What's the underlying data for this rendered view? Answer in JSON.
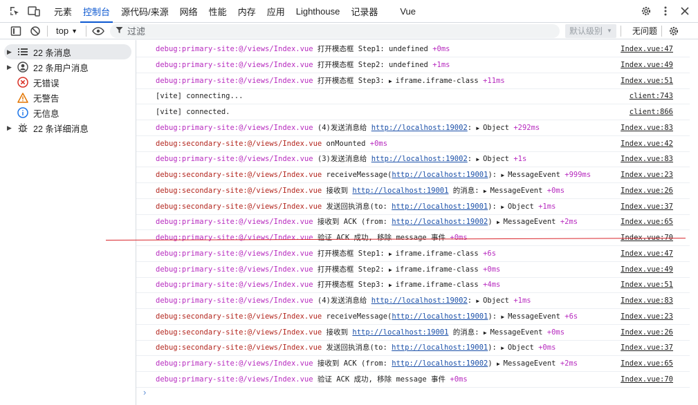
{
  "tabs": {
    "items": [
      "元素",
      "控制台",
      "源代码/来源",
      "网络",
      "性能",
      "内存",
      "应用",
      "Lighthouse",
      "记录器",
      "Vue"
    ],
    "active_index": 1
  },
  "toolbar": {
    "context": "top",
    "filter_placeholder": "过滤",
    "level_label": "默认级别",
    "issues_label": "无问题"
  },
  "sidebar": {
    "items": [
      {
        "label": "22 条消息",
        "icon": "list-icon",
        "expandable": true,
        "selected": true
      },
      {
        "label": "22 条用户消息",
        "icon": "user-icon",
        "expandable": true,
        "selected": false
      },
      {
        "label": "无错误",
        "icon": "error-icon",
        "expandable": false,
        "selected": false
      },
      {
        "label": "无警告",
        "icon": "warning-icon",
        "expandable": false,
        "selected": false
      },
      {
        "label": "无信息",
        "icon": "info-icon",
        "expandable": false,
        "selected": false
      },
      {
        "label": "22 条详细消息",
        "icon": "bug-icon",
        "expandable": true,
        "selected": false
      }
    ]
  },
  "console": {
    "rows": [
      {
        "prefix": "debug:primary-site:@/views/Index.vue",
        "kind": "pri",
        "parts": [
          {
            "t": "text",
            "v": " 打开模态框 Step1: undefined "
          },
          {
            "t": "time",
            "v": "+0ms"
          }
        ],
        "source": "Index.vue:47"
      },
      {
        "prefix": "debug:primary-site:@/views/Index.vue",
        "kind": "pri",
        "parts": [
          {
            "t": "text",
            "v": " 打开模态框 Step2: undefined "
          },
          {
            "t": "time",
            "v": "+1ms"
          }
        ],
        "source": "Index.vue:49"
      },
      {
        "prefix": "debug:primary-site:@/views/Index.vue",
        "kind": "pri",
        "parts": [
          {
            "t": "text",
            "v": " 打开模态框 Step3: "
          },
          {
            "t": "obj",
            "v": "iframe.iframe-class"
          },
          {
            "t": "text",
            "v": " "
          },
          {
            "t": "time",
            "v": "+11ms"
          }
        ],
        "source": "Index.vue:51"
      },
      {
        "prefix": "",
        "kind": "plain",
        "parts": [
          {
            "t": "text",
            "v": "[vite] connecting..."
          }
        ],
        "source": "client:743"
      },
      {
        "prefix": "",
        "kind": "plain",
        "parts": [
          {
            "t": "text",
            "v": "[vite] connected."
          }
        ],
        "source": "client:866"
      },
      {
        "prefix": "debug:primary-site:@/views/Index.vue",
        "kind": "pri",
        "parts": [
          {
            "t": "text",
            "v": " (4)发送消息给 "
          },
          {
            "t": "link",
            "v": "http://localhost:19002"
          },
          {
            "t": "text",
            "v": ": "
          },
          {
            "t": "obj",
            "v": "Object"
          },
          {
            "t": "text",
            "v": " "
          },
          {
            "t": "time",
            "v": "+292ms"
          }
        ],
        "source": "Index.vue:83"
      },
      {
        "prefix": "debug:secondary-site:@/views/Index.vue",
        "kind": "sec",
        "parts": [
          {
            "t": "text",
            "v": " onMounted "
          },
          {
            "t": "time",
            "v": "+0ms"
          }
        ],
        "source": "Index.vue:42"
      },
      {
        "prefix": "debug:primary-site:@/views/Index.vue",
        "kind": "pri",
        "parts": [
          {
            "t": "text",
            "v": " (3)发送消息给 "
          },
          {
            "t": "link",
            "v": "http://localhost:19002"
          },
          {
            "t": "text",
            "v": ": "
          },
          {
            "t": "obj",
            "v": "Object"
          },
          {
            "t": "text",
            "v": " "
          },
          {
            "t": "time",
            "v": "+1s"
          }
        ],
        "source": "Index.vue:83"
      },
      {
        "prefix": "debug:secondary-site:@/views/Index.vue",
        "kind": "sec",
        "parts": [
          {
            "t": "text",
            "v": " receiveMessage("
          },
          {
            "t": "link",
            "v": "http://localhost:19001"
          },
          {
            "t": "text",
            "v": "): "
          },
          {
            "t": "obj",
            "v": "MessageEvent"
          },
          {
            "t": "text",
            "v": " "
          },
          {
            "t": "time",
            "v": "+999ms"
          }
        ],
        "source": "Index.vue:23"
      },
      {
        "prefix": "debug:secondary-site:@/views/Index.vue",
        "kind": "sec",
        "parts": [
          {
            "t": "text",
            "v": " 接收到 "
          },
          {
            "t": "link",
            "v": "http://localhost:19001"
          },
          {
            "t": "text",
            "v": " 的消息: "
          },
          {
            "t": "obj",
            "v": "MessageEvent"
          },
          {
            "t": "text",
            "v": " "
          },
          {
            "t": "time",
            "v": "+0ms"
          }
        ],
        "source": "Index.vue:26"
      },
      {
        "prefix": "debug:secondary-site:@/views/Index.vue",
        "kind": "sec",
        "parts": [
          {
            "t": "text",
            "v": " 发送回执消息(to: "
          },
          {
            "t": "link",
            "v": "http://localhost:19001"
          },
          {
            "t": "text",
            "v": "): "
          },
          {
            "t": "obj",
            "v": "Object"
          },
          {
            "t": "text",
            "v": " "
          },
          {
            "t": "time",
            "v": "+1ms"
          }
        ],
        "source": "Index.vue:37"
      },
      {
        "prefix": "debug:primary-site:@/views/Index.vue",
        "kind": "pri",
        "parts": [
          {
            "t": "text",
            "v": " 接收到 ACK (from: "
          },
          {
            "t": "link",
            "v": "http://localhost:19002"
          },
          {
            "t": "text",
            "v": ") "
          },
          {
            "t": "obj",
            "v": "MessageEvent"
          },
          {
            "t": "text",
            "v": " "
          },
          {
            "t": "time",
            "v": "+2ms"
          }
        ],
        "source": "Index.vue:65"
      },
      {
        "prefix": "debug:primary-site:@/views/Index.vue",
        "kind": "pri",
        "parts": [
          {
            "t": "text",
            "v": " 验证 ACK 成功, 移除 message 事件 "
          },
          {
            "t": "time",
            "v": "+0ms"
          }
        ],
        "source": "Index.vue:70"
      },
      {
        "prefix": "debug:primary-site:@/views/Index.vue",
        "kind": "pri",
        "parts": [
          {
            "t": "text",
            "v": " 打开模态框 Step1: "
          },
          {
            "t": "obj",
            "v": "iframe.iframe-class"
          },
          {
            "t": "text",
            "v": " "
          },
          {
            "t": "time",
            "v": "+6s"
          }
        ],
        "source": "Index.vue:47"
      },
      {
        "prefix": "debug:primary-site:@/views/Index.vue",
        "kind": "pri",
        "parts": [
          {
            "t": "text",
            "v": " 打开模态框 Step2: "
          },
          {
            "t": "obj",
            "v": "iframe.iframe-class"
          },
          {
            "t": "text",
            "v": " "
          },
          {
            "t": "time",
            "v": "+0ms"
          }
        ],
        "source": "Index.vue:49"
      },
      {
        "prefix": "debug:primary-site:@/views/Index.vue",
        "kind": "pri",
        "parts": [
          {
            "t": "text",
            "v": " 打开模态框 Step3: "
          },
          {
            "t": "obj",
            "v": "iframe.iframe-class"
          },
          {
            "t": "text",
            "v": " "
          },
          {
            "t": "time",
            "v": "+4ms"
          }
        ],
        "source": "Index.vue:51"
      },
      {
        "prefix": "debug:primary-site:@/views/Index.vue",
        "kind": "pri",
        "parts": [
          {
            "t": "text",
            "v": " (4)发送消息给 "
          },
          {
            "t": "link",
            "v": "http://localhost:19002"
          },
          {
            "t": "text",
            "v": ": "
          },
          {
            "t": "obj",
            "v": "Object"
          },
          {
            "t": "text",
            "v": " "
          },
          {
            "t": "time",
            "v": "+1ms"
          }
        ],
        "source": "Index.vue:83"
      },
      {
        "prefix": "debug:secondary-site:@/views/Index.vue",
        "kind": "sec",
        "parts": [
          {
            "t": "text",
            "v": " receiveMessage("
          },
          {
            "t": "link",
            "v": "http://localhost:19001"
          },
          {
            "t": "text",
            "v": "): "
          },
          {
            "t": "obj",
            "v": "MessageEvent"
          },
          {
            "t": "text",
            "v": " "
          },
          {
            "t": "time",
            "v": "+6s"
          }
        ],
        "source": "Index.vue:23"
      },
      {
        "prefix": "debug:secondary-site:@/views/Index.vue",
        "kind": "sec",
        "parts": [
          {
            "t": "text",
            "v": " 接收到 "
          },
          {
            "t": "link",
            "v": "http://localhost:19001"
          },
          {
            "t": "text",
            "v": " 的消息: "
          },
          {
            "t": "obj",
            "v": "MessageEvent"
          },
          {
            "t": "text",
            "v": " "
          },
          {
            "t": "time",
            "v": "+0ms"
          }
        ],
        "source": "Index.vue:26"
      },
      {
        "prefix": "debug:secondary-site:@/views/Index.vue",
        "kind": "sec",
        "parts": [
          {
            "t": "text",
            "v": " 发送回执消息(to: "
          },
          {
            "t": "link",
            "v": "http://localhost:19001"
          },
          {
            "t": "text",
            "v": "): "
          },
          {
            "t": "obj",
            "v": "Object"
          },
          {
            "t": "text",
            "v": " "
          },
          {
            "t": "time",
            "v": "+0ms"
          }
        ],
        "source": "Index.vue:37"
      },
      {
        "prefix": "debug:primary-site:@/views/Index.vue",
        "kind": "pri",
        "parts": [
          {
            "t": "text",
            "v": " 接收到 ACK (from: "
          },
          {
            "t": "link",
            "v": "http://localhost:19002"
          },
          {
            "t": "text",
            "v": ") "
          },
          {
            "t": "obj",
            "v": "MessageEvent"
          },
          {
            "t": "text",
            "v": " "
          },
          {
            "t": "time",
            "v": "+2ms"
          }
        ],
        "source": "Index.vue:65"
      },
      {
        "prefix": "debug:primary-site:@/views/Index.vue",
        "kind": "pri",
        "parts": [
          {
            "t": "text",
            "v": " 验证 ACK 成功, 移除 message 事件 "
          },
          {
            "t": "time",
            "v": "+0ms"
          }
        ],
        "source": "Index.vue:70"
      }
    ],
    "prompt": "›"
  },
  "colors": {
    "accent": "#0b57d0",
    "primary_prefix": "#b72bbf",
    "secondary_prefix": "#b3261e",
    "annotation_line": "#d9262c"
  }
}
